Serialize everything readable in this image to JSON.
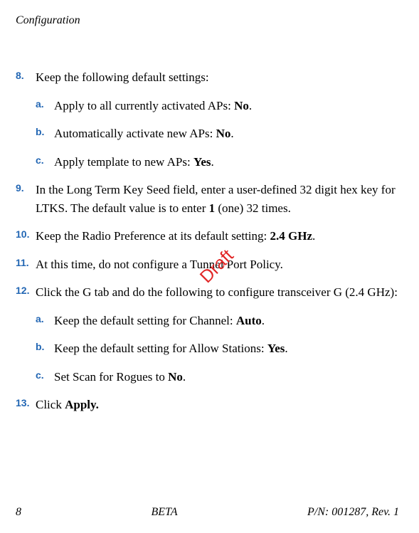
{
  "header": {
    "title": "Configuration"
  },
  "watermark": "Draft",
  "steps": {
    "s8": {
      "marker": "8.",
      "text_a": "Keep the following default settings:"
    },
    "s8a": {
      "marker": "a.",
      "text_a": "Apply to all currently activated APs: ",
      "bold": "No",
      "text_b": "."
    },
    "s8b": {
      "marker": "b.",
      "text_a": "Automatically activate new APs: ",
      "bold": "No",
      "text_b": "."
    },
    "s8c": {
      "marker": "c.",
      "text_a": "Apply template to new APs: ",
      "bold": "Yes",
      "text_b": "."
    },
    "s9": {
      "marker": "9.",
      "text_a": "In the Long Term Key Seed field, enter a user-defined 32 digit hex key for LTKS. The default value is to enter ",
      "bold": "1",
      "text_b": " (one) 32 times."
    },
    "s10": {
      "marker": "10.",
      "text_a": "Keep the Radio Preference at its default setting: ",
      "bold": "2.4 GHz",
      "text_b": "."
    },
    "s11": {
      "marker": "11.",
      "text_a": "At this time, do not configure a Tunnel Port Policy."
    },
    "s12": {
      "marker": "12.",
      "text_a": "Click the G tab and do the following to configure transceiver G (2.4 GHz):"
    },
    "s12a": {
      "marker": "a.",
      "text_a": "Keep the default setting for Channel: ",
      "bold": "Auto",
      "text_b": "."
    },
    "s12b": {
      "marker": "b.",
      "text_a": "Keep the default setting for Allow Stations: ",
      "bold": "Yes",
      "text_b": "."
    },
    "s12c": {
      "marker": "c.",
      "text_a": "Set Scan for Rogues to ",
      "bold": "No",
      "text_b": "."
    },
    "s13": {
      "marker": "13.",
      "text_a": "Click ",
      "bold": "Apply."
    }
  },
  "footer": {
    "page": "8",
    "center": "BETA",
    "right": "P/N: 001287, Rev. 1"
  }
}
